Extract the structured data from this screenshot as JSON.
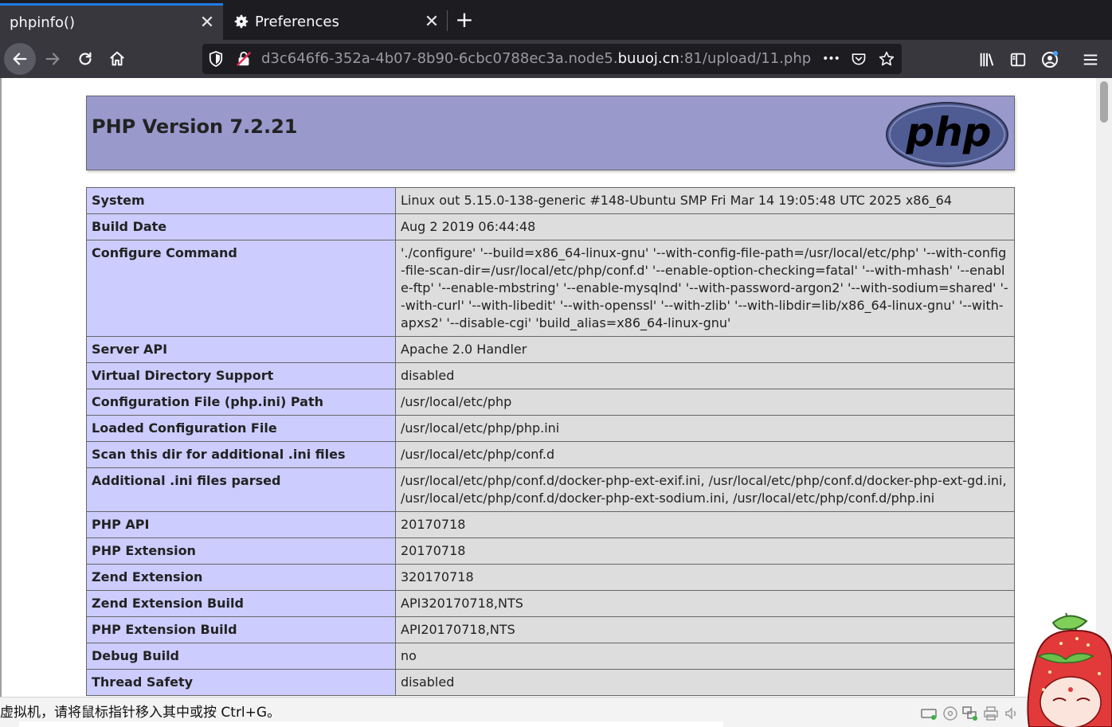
{
  "browser": {
    "tabs": [
      {
        "title": "phpinfo()",
        "active": true
      },
      {
        "title": "Preferences",
        "active": false,
        "icon": "gear-icon"
      }
    ],
    "new_tab_label": "+",
    "close_glyph": "✕",
    "url": {
      "prefix": "d3c646f6-352a-4b07-8b90-6cbc0788ec3a.node5.",
      "domain": "buuoj.cn",
      "suffix": ":81/upload/11.php"
    },
    "menu_dots": "•••"
  },
  "phpinfo": {
    "title": "PHP Version 7.2.21",
    "logo_text": "php",
    "rows": [
      {
        "label": "System",
        "value": "Linux out 5.15.0-138-generic #148-Ubuntu SMP Fri Mar 14 19:05:48 UTC 2025 x86_64"
      },
      {
        "label": "Build Date",
        "value": "Aug 2 2019 06:44:48"
      },
      {
        "label": "Configure Command",
        "value": "'./configure' '--build=x86_64-linux-gnu' '--with-config-file-path=/usr/local/etc/php' '--with-config-file-scan-dir=/usr/local/etc/php/conf.d' '--enable-option-checking=fatal' '--with-mhash' '--enable-ftp' '--enable-mbstring' '--enable-mysqlnd' '--with-password-argon2' '--with-sodium=shared' '--with-curl' '--with-libedit' '--with-openssl' '--with-zlib' '--with-libdir=lib/x86_64-linux-gnu' '--with-apxs2' '--disable-cgi' 'build_alias=x86_64-linux-gnu'"
      },
      {
        "label": "Server API",
        "value": "Apache 2.0 Handler"
      },
      {
        "label": "Virtual Directory Support",
        "value": "disabled"
      },
      {
        "label": "Configuration File (php.ini) Path",
        "value": "/usr/local/etc/php"
      },
      {
        "label": "Loaded Configuration File",
        "value": "/usr/local/etc/php/php.ini"
      },
      {
        "label": "Scan this dir for additional .ini files",
        "value": "/usr/local/etc/php/conf.d"
      },
      {
        "label": "Additional .ini files parsed",
        "value": "/usr/local/etc/php/conf.d/docker-php-ext-exif.ini, /usr/local/etc/php/conf.d/docker-php-ext-gd.ini, /usr/local/etc/php/conf.d/docker-php-ext-sodium.ini, /usr/local/etc/php/conf.d/php.ini"
      },
      {
        "label": "PHP API",
        "value": "20170718"
      },
      {
        "label": "PHP Extension",
        "value": "20170718"
      },
      {
        "label": "Zend Extension",
        "value": "320170718"
      },
      {
        "label": "Zend Extension Build",
        "value": "API320170718,NTS"
      },
      {
        "label": "PHP Extension Build",
        "value": "API20170718,NTS"
      },
      {
        "label": "Debug Build",
        "value": "no"
      },
      {
        "label": "Thread Safety",
        "value": "disabled"
      }
    ]
  },
  "vm_status": {
    "message": "虚拟机，请将鼠标指针移入其中或按 Ctrl+G。"
  },
  "colors": {
    "php_header_bg": "#9999cc",
    "label_cell_bg": "#ccccff",
    "value_cell_bg": "#dddddd",
    "tab_accent": "#1e7ae6"
  }
}
